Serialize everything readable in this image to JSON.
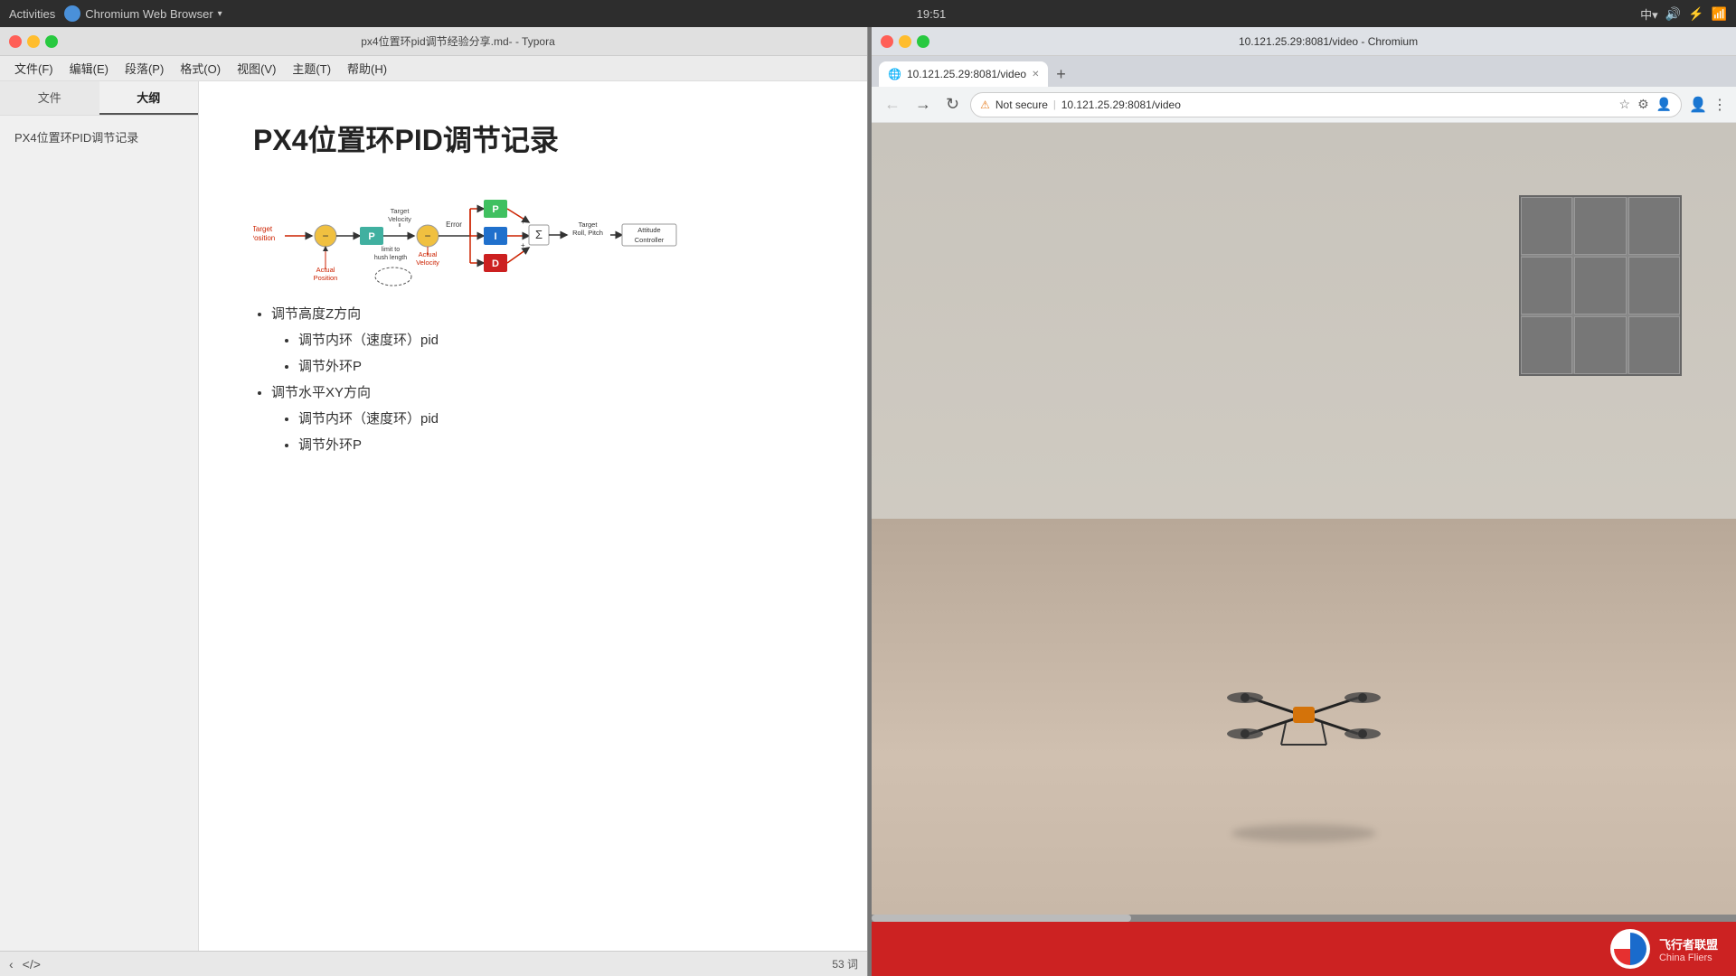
{
  "system_bar": {
    "activities": "Activities",
    "browser_name": "Chromium Web Browser",
    "time": "19:51",
    "input_method": "中▾"
  },
  "typora": {
    "title": "px4位置环pid调节经验分享.md- - Typora",
    "menus": [
      "文件(F)",
      "编辑(E)",
      "段落(P)",
      "格式(O)",
      "视图(V)",
      "主题(T)",
      "帮助(H)"
    ],
    "sidebar_tabs": [
      "文件",
      "大纲"
    ],
    "active_tab": "大纲",
    "outline_item": "PX4位置环PID调节记录",
    "doc_title": "PX4位置环PID调节记录",
    "bullet_items": [
      {
        "text": "调节高度Z方向",
        "level": 1
      },
      {
        "text": "调节内环（速度环）pid",
        "level": 2
      },
      {
        "text": "调节外环P",
        "level": 2
      },
      {
        "text": "调节水平XY方向",
        "level": 1
      },
      {
        "text": "调节内环（速度环）pid",
        "level": 2
      },
      {
        "text": "调节外环P",
        "level": 2
      }
    ],
    "word_count": "53 词",
    "window_buttons": {
      "close": "×",
      "min": "−",
      "max": "+"
    }
  },
  "chromium": {
    "title": "10.121.25.29:8081/video - Chromium",
    "tab_title": "10.121.25.29:8081/video",
    "url": "10.121.25.29:8081/video",
    "security": "Not secure",
    "logo_text": "飞行者联盟\nChina Fliers"
  },
  "pid_diagram": {
    "blocks": {
      "P_outer": "P",
      "P_inner": "P",
      "I_inner": "I",
      "D_inner": "D",
      "sigma": "Σ",
      "attitude": "Attitude\nController"
    },
    "labels": {
      "target_position": "Target\nPosition",
      "target_velocity": "Target\nVelocity",
      "error": "Error",
      "actual_position": "Actual\nPosition",
      "actual_velocity": "Actual\nVelocity",
      "target_roll_pitch": "Target\nRoll, Pitch",
      "limit": "limit to\nhush length"
    }
  }
}
